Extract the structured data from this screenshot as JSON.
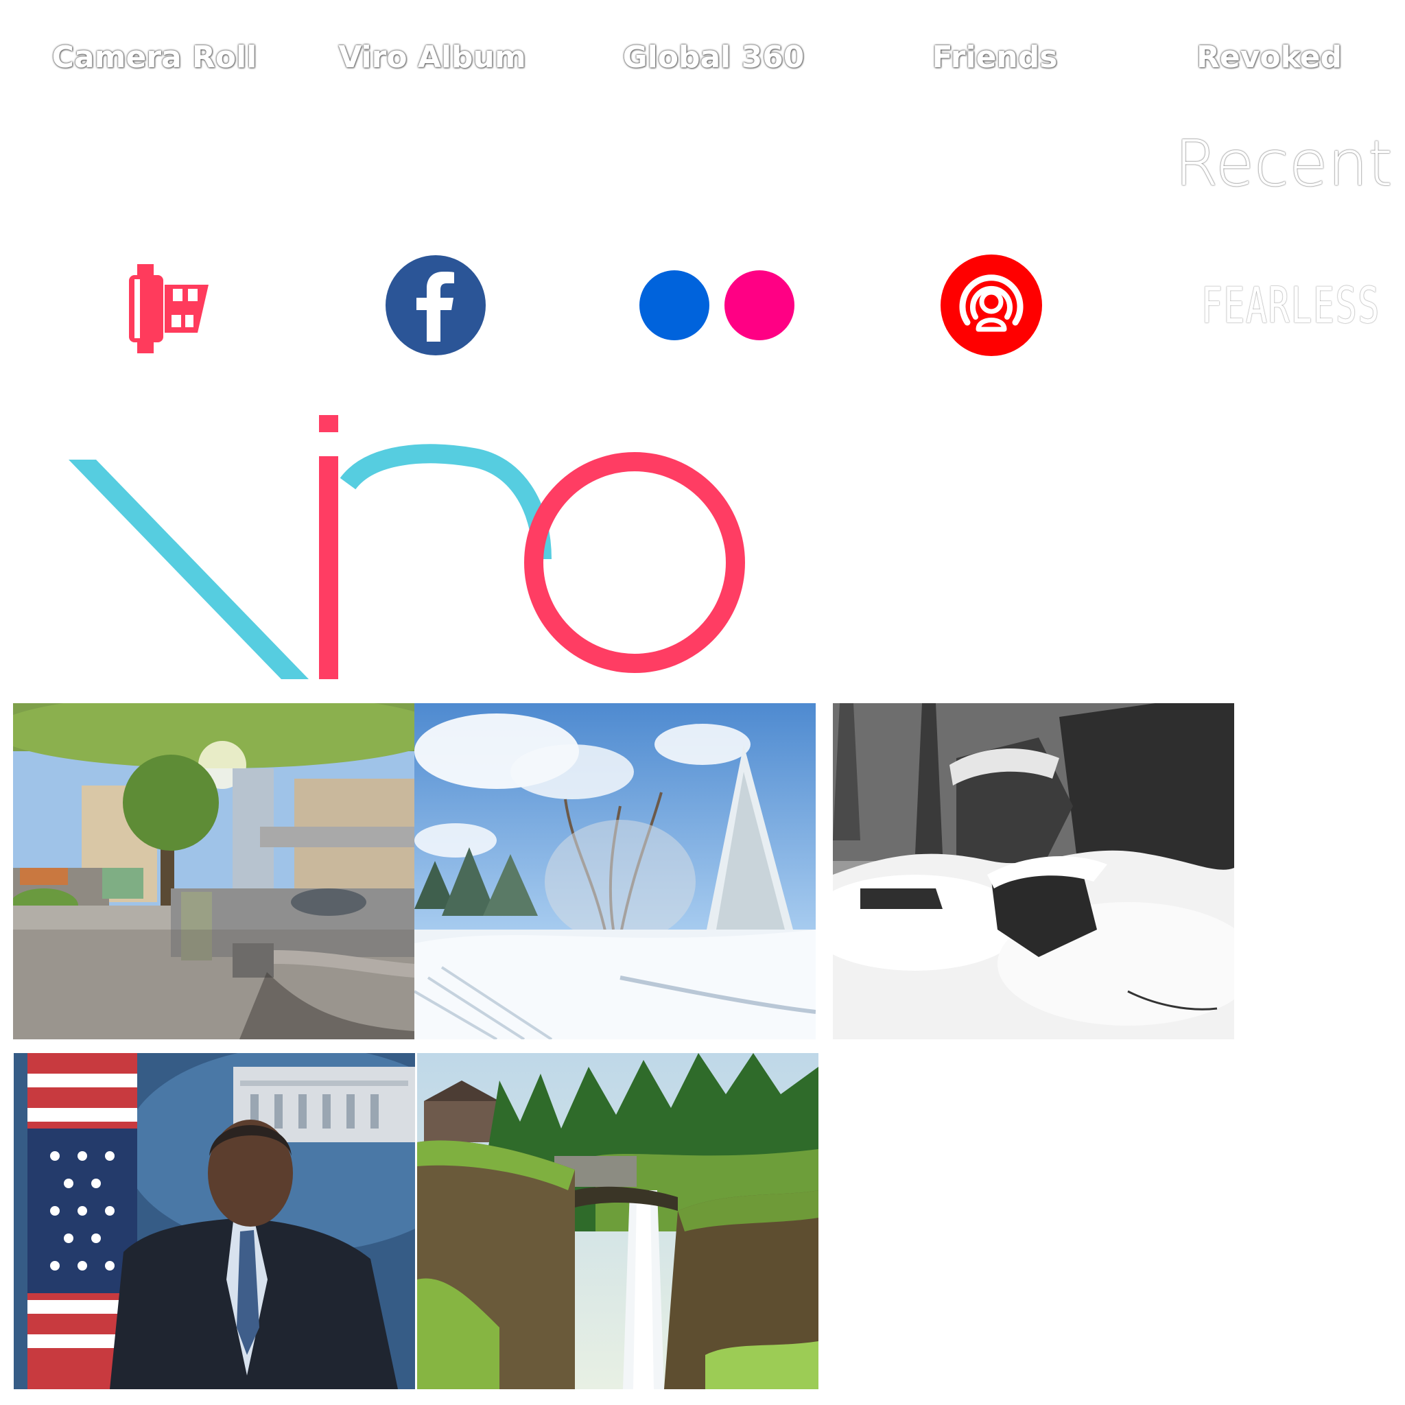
{
  "tabs": {
    "camera_roll": "Camera Roll",
    "viro_album": "Viro Album",
    "global_360": "Global 360",
    "friends": "Friends",
    "revoked": "Revoked"
  },
  "section": {
    "recent": "Recent"
  },
  "sources": [
    {
      "icon": "film-roll-icon",
      "color": "#ff3b5c"
    },
    {
      "icon": "facebook-icon",
      "color": "#2b5597"
    },
    {
      "icon": "flickr-icon",
      "colors": [
        "#0063dc",
        "#ff0084"
      ]
    },
    {
      "icon": "periscope-icon",
      "color": "#ff0000"
    },
    {
      "icon": "fearless-logo",
      "label": "FEARLESS"
    }
  ],
  "logo": {
    "text": "viro",
    "colors": {
      "teal": "#56cde0",
      "pink": "#ff3d63"
    }
  },
  "thumbnails": [
    {
      "subject": "city-street-360"
    },
    {
      "subject": "snowy-forest"
    },
    {
      "subject": "snowy-rocks-bw"
    },
    {
      "subject": "press-briefing"
    },
    {
      "subject": "waterfall"
    }
  ]
}
